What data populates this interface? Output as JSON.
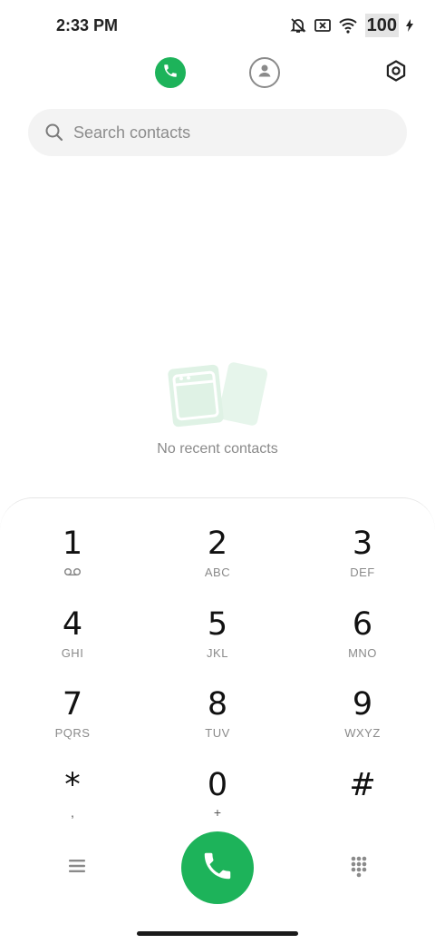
{
  "status_bar": {
    "time": "2:33 PM",
    "battery": "100"
  },
  "header": {
    "tabs": [
      {
        "name": "tab-recents",
        "icon": "phone-icon",
        "active": true
      },
      {
        "name": "tab-contacts",
        "icon": "person-icon",
        "active": false
      }
    ],
    "settings_icon": "settings-icon"
  },
  "search": {
    "placeholder": "Search contacts",
    "value": ""
  },
  "empty_state": {
    "text": "No recent contacts"
  },
  "dialpad": {
    "keys": [
      {
        "digit": "1",
        "letters": ""
      },
      {
        "digit": "2",
        "letters": "ABC"
      },
      {
        "digit": "3",
        "letters": "DEF"
      },
      {
        "digit": "4",
        "letters": "GHI"
      },
      {
        "digit": "5",
        "letters": "JKL"
      },
      {
        "digit": "6",
        "letters": "MNO"
      },
      {
        "digit": "7",
        "letters": "PQRS"
      },
      {
        "digit": "8",
        "letters": "TUV"
      },
      {
        "digit": "9",
        "letters": "WXYZ"
      },
      {
        "digit": "*",
        "letters": ","
      },
      {
        "digit": "0",
        "letters": "+"
      },
      {
        "digit": "#",
        "letters": ""
      }
    ]
  },
  "colors": {
    "accent": "#1db35a",
    "search_bg": "#f3f3f3",
    "muted_text": "#8a8a8a"
  }
}
